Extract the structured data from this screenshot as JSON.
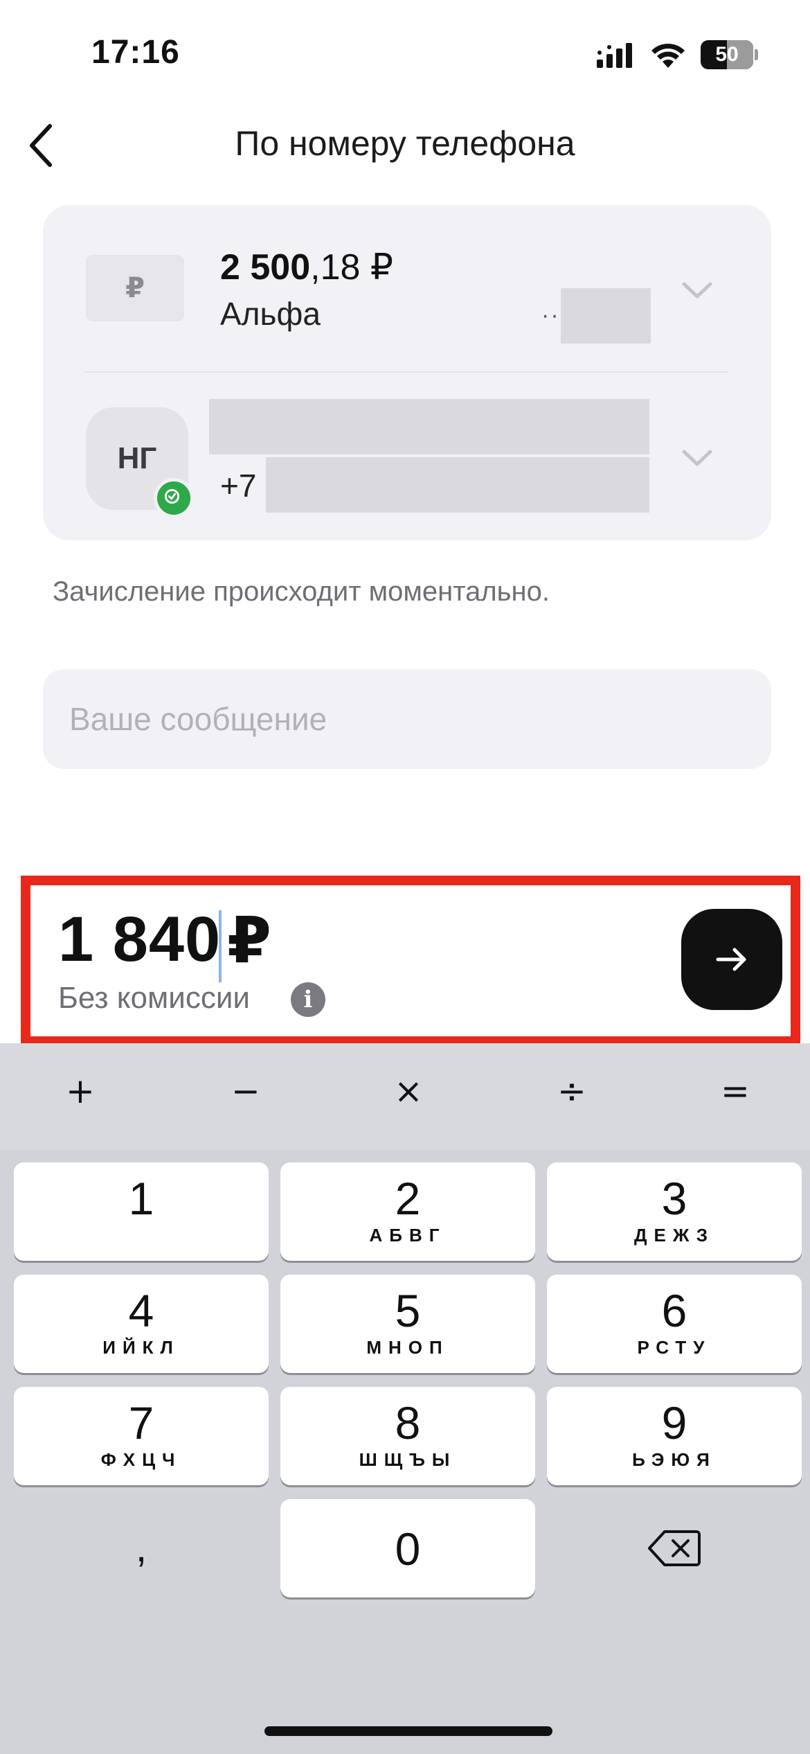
{
  "status_bar": {
    "time": "17:16",
    "battery": "50"
  },
  "header": {
    "title": "По номеру телефона"
  },
  "account": {
    "currency_icon": "₽",
    "amount_int": "2 500",
    "amount_frac": ",18 ₽",
    "name": "Альфа",
    "mask_dots": "··"
  },
  "recipient": {
    "initials": "НГ",
    "phone_prefix": "+7"
  },
  "info_text": "Зачисление происходит моментально.",
  "message": {
    "placeholder": "Ваше сообщение",
    "value": ""
  },
  "amount": {
    "value": "1 840",
    "currency": "₽",
    "fee_label": "Без комиссии",
    "info_glyph": "i"
  },
  "keyboard": {
    "ops": [
      "+",
      "−",
      "×",
      "÷",
      "="
    ],
    "keys": [
      {
        "digit": "1",
        "letters": ""
      },
      {
        "digit": "2",
        "letters": "АБВГ"
      },
      {
        "digit": "3",
        "letters": "ДЕЖЗ"
      },
      {
        "digit": "4",
        "letters": "ИЙКЛ"
      },
      {
        "digit": "5",
        "letters": "МНОП"
      },
      {
        "digit": "6",
        "letters": "РСТУ"
      },
      {
        "digit": "7",
        "letters": "ФХЦЧ"
      },
      {
        "digit": "8",
        "letters": "ШЩЪЫ"
      },
      {
        "digit": "9",
        "letters": "ЬЭЮЯ"
      },
      {
        "digit": "0",
        "letters": ""
      }
    ],
    "comma": ","
  },
  "icons": {
    "back": "chevron-left-icon",
    "next": "arrow-right-icon",
    "backspace": "backspace-icon",
    "verified": "check-circle-icon"
  },
  "colors": {
    "highlight_border": "#e8281b",
    "verified_badge": "#2ea94a",
    "next_button": "#111111"
  }
}
